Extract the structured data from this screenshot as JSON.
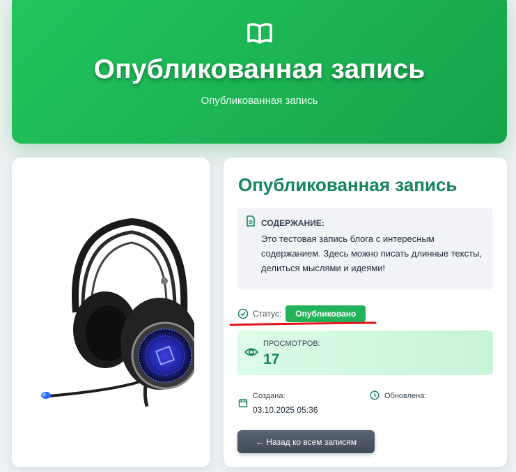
{
  "hero": {
    "title": "Опубликованная запись",
    "subtitle": "Опубликованная запись",
    "icon": "book-open-icon"
  },
  "post": {
    "title": "Опубликованная запись",
    "image": "headset-product-image",
    "content_label": "СОДЕРЖАНИЕ:",
    "content_text": "Это тестовая запись блога с интересным содержанием. Здесь можно писать длинные тексты, делиться мыслями и идеями!",
    "status_label": "Статус:",
    "status_value": "Опубликовано",
    "views_label": "ПРОСМОТРОВ:",
    "views_value": "17",
    "created_label": "Создана:",
    "created_value": "03.10.2025 05:36",
    "updated_label": "Обновлена:",
    "updated_value": "",
    "back_button": "← Назад ко всем записям"
  },
  "colors": {
    "hero_green": "#22c55e",
    "title_green": "#15855a",
    "badge_green": "#22b25a",
    "annotation_red": "#e3121b"
  }
}
